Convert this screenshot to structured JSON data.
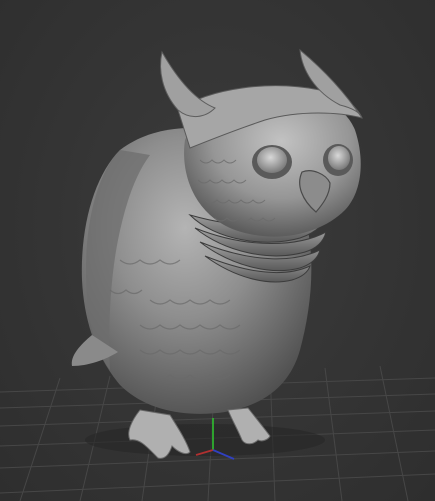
{
  "viewport": {
    "subject": "owl-sculpt-model",
    "background_color": "#353535",
    "grid_color": "#4a4a4a",
    "model_color": "#8f8f8f",
    "gizmo": {
      "x_axis_color": "#b03030",
      "y_axis_color": "#2fb02f",
      "z_axis_color": "#3040c0"
    }
  }
}
